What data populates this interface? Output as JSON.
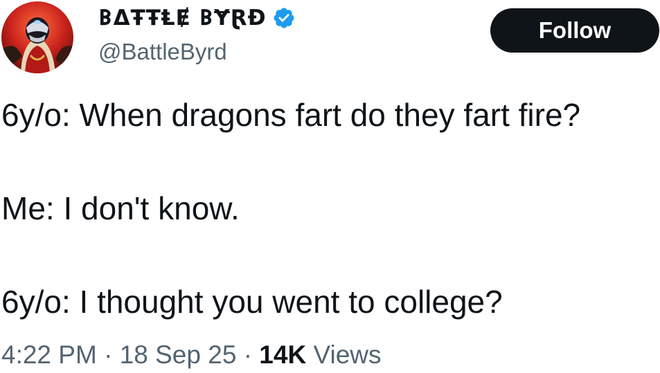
{
  "author": {
    "display_name": "𐌁ΔŦŦⱠɆ 𐌁ɎⱤĐ",
    "handle": "@BattleByrd",
    "verified": true,
    "avatar_icon": "masked-figure-avatar"
  },
  "follow_button": {
    "label": "Follow"
  },
  "tweet": {
    "lines": [
      "6y/o: When dragons fart do they fart fire?",
      "Me: I don't know.",
      "6y/o: I thought you went to college?"
    ]
  },
  "meta": {
    "time": "4:22 PM",
    "separator": "·",
    "date": "18 Sep 25",
    "views_count": "14K",
    "views_label": "Views"
  },
  "colors": {
    "text_primary": "#0f1419",
    "text_secondary": "#536471",
    "verified_blue": "#1d9bf0",
    "follow_bg": "#0f1419"
  }
}
